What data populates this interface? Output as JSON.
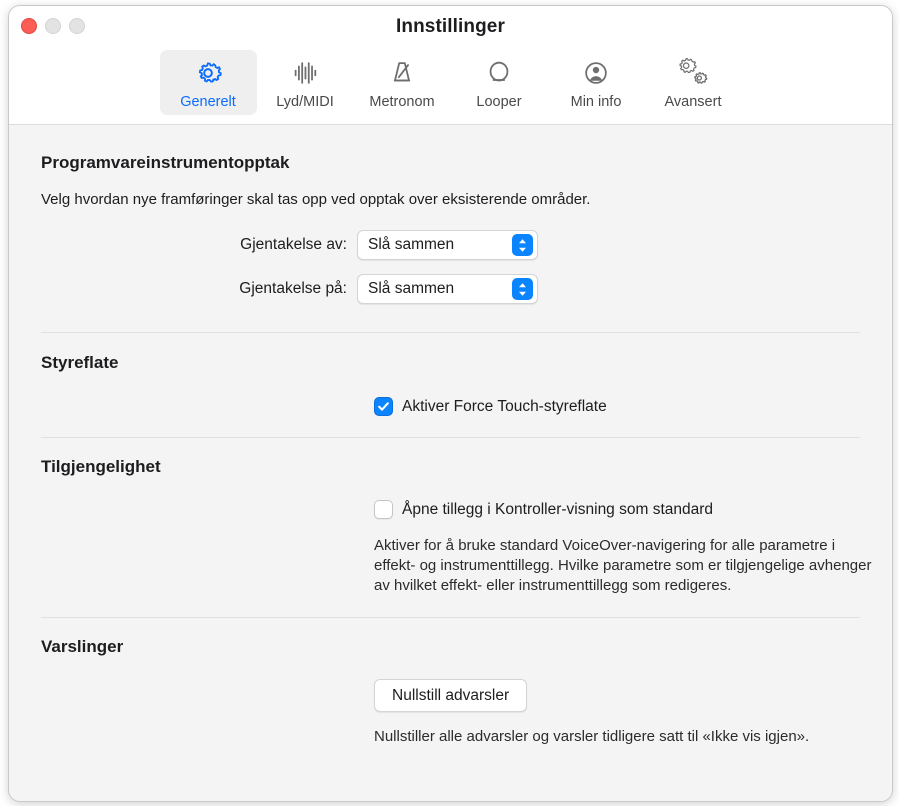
{
  "window": {
    "title": "Innstillinger",
    "controls": {
      "close": "close-button",
      "minimize": "minimize-button",
      "zoom": "zoom-button"
    }
  },
  "toolbar": {
    "tabs": [
      {
        "label": "Generelt",
        "icon": "gear-icon",
        "selected": true
      },
      {
        "label": "Lyd/MIDI",
        "icon": "waveform-icon",
        "selected": false
      },
      {
        "label": "Metronom",
        "icon": "metronome-icon",
        "selected": false
      },
      {
        "label": "Looper",
        "icon": "loop-icon",
        "selected": false
      },
      {
        "label": "Min info",
        "icon": "person-icon",
        "selected": false
      },
      {
        "label": "Avansert",
        "icon": "gears-icon",
        "selected": false
      }
    ]
  },
  "sections": {
    "software_instrument": {
      "title": "Programvareinstrumentopptak",
      "description": "Velg hvordan nye framføringer skal tas opp ved opptak over eksisterende områder.",
      "merge_off": {
        "label": "Gjentakelse av:",
        "value": "Slå sammen"
      },
      "merge_on": {
        "label": "Gjentakelse på:",
        "value": "Slå sammen"
      }
    },
    "trackpad": {
      "title": "Styreflate",
      "force_touch": {
        "label": "Aktiver Force Touch-styreflate",
        "checked": true
      }
    },
    "accessibility": {
      "title": "Tilgjengelighet",
      "controller_view": {
        "label": "Åpne tillegg i Kontroller-visning som standard",
        "checked": false
      },
      "help": "Aktiver for å bruke standard VoiceOver-navigering for alle parametre i effekt- og instrumenttillegg. Hvilke parametre som er tilgjengelige avhenger av hvilket effekt- eller instrumenttillegg som redigeres."
    },
    "notifications": {
      "title": "Varslinger",
      "reset_button": "Nullstill advarsler",
      "help": "Nullstiller alle advarsler og varsler tidligere satt til «Ikke vis igjen»."
    }
  },
  "colors": {
    "accent": "#0a84ff",
    "selected_tab_text": "#0a6cff",
    "close": "#fc5d55",
    "inactive_light": "#e3e3e3",
    "content_bg": "#f4f4f4",
    "separator": "#e0e0e0"
  }
}
